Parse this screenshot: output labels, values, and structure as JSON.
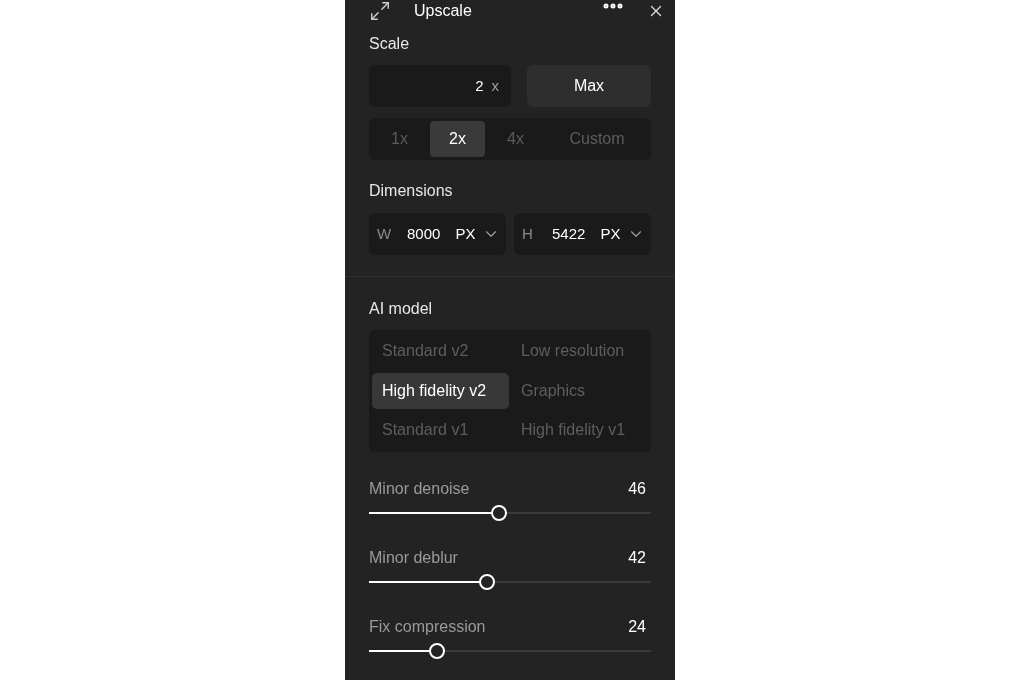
{
  "header": {
    "title": "Upscale"
  },
  "scale": {
    "label": "Scale",
    "value": "2",
    "unit": "x",
    "max_button": "Max",
    "presets": [
      {
        "label": "1x",
        "selected": false
      },
      {
        "label": "2x",
        "selected": true
      },
      {
        "label": "4x",
        "selected": false
      },
      {
        "label": "Custom",
        "selected": false
      }
    ]
  },
  "dimensions": {
    "label": "Dimensions",
    "fields": [
      {
        "axis": "W",
        "value": "8000",
        "unit": "PX"
      },
      {
        "axis": "H",
        "value": "5422",
        "unit": "PX"
      }
    ]
  },
  "ai_model": {
    "label": "AI model",
    "options": [
      {
        "label": "Standard v2",
        "selected": false
      },
      {
        "label": "Low resolution",
        "selected": false
      },
      {
        "label": "High fidelity v2",
        "selected": true
      },
      {
        "label": "Graphics",
        "selected": false
      },
      {
        "label": "Standard v1",
        "selected": false
      },
      {
        "label": "High fidelity v1",
        "selected": false
      }
    ]
  },
  "sliders": [
    {
      "label": "Minor denoise",
      "value": "46",
      "level": 0.46
    },
    {
      "label": "Minor deblur",
      "value": "42",
      "level": 0.42
    },
    {
      "label": "Fix compression",
      "value": "24",
      "level": 0.24
    }
  ]
}
